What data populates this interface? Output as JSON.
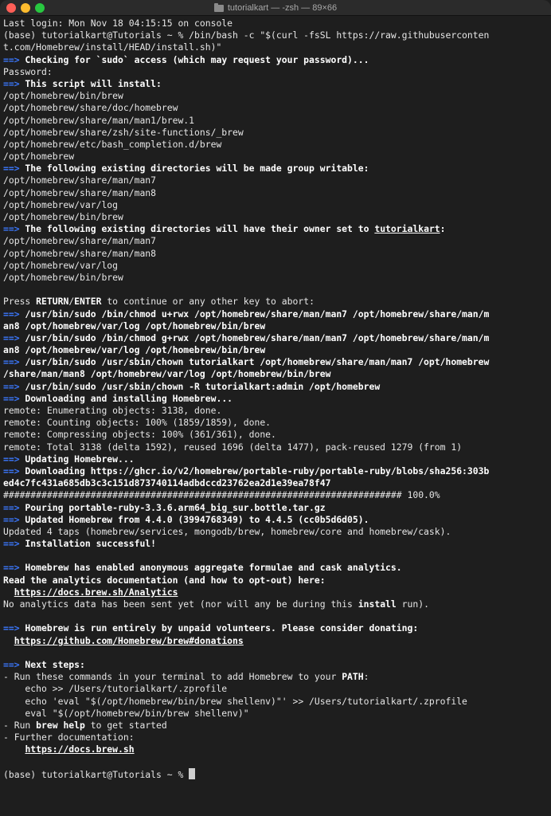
{
  "window": {
    "title": "tutorialkart — -zsh — 89×66"
  },
  "terminal": {
    "lines": [
      {
        "segments": [
          {
            "t": "text",
            "v": "Last login: Mon Nov 18 04:15:15 on console"
          }
        ]
      },
      {
        "segments": [
          {
            "t": "text",
            "v": "(base) tutorialkart@Tutorials ~ % /bin/bash -c \"$(curl -fsSL https://raw.githubuserconten"
          }
        ]
      },
      {
        "segments": [
          {
            "t": "text",
            "v": "t.com/Homebrew/install/HEAD/install.sh)\""
          }
        ]
      },
      {
        "segments": [
          {
            "t": "arrow",
            "v": "==>"
          },
          {
            "t": "bold",
            "v": " Checking for `sudo` access (which may request your password)..."
          }
        ]
      },
      {
        "segments": [
          {
            "t": "text",
            "v": "Password:"
          }
        ]
      },
      {
        "segments": [
          {
            "t": "arrow",
            "v": "==>"
          },
          {
            "t": "bold",
            "v": " This script will install:"
          }
        ]
      },
      {
        "segments": [
          {
            "t": "text",
            "v": "/opt/homebrew/bin/brew"
          }
        ]
      },
      {
        "segments": [
          {
            "t": "text",
            "v": "/opt/homebrew/share/doc/homebrew"
          }
        ]
      },
      {
        "segments": [
          {
            "t": "text",
            "v": "/opt/homebrew/share/man/man1/brew.1"
          }
        ]
      },
      {
        "segments": [
          {
            "t": "text",
            "v": "/opt/homebrew/share/zsh/site-functions/_brew"
          }
        ]
      },
      {
        "segments": [
          {
            "t": "text",
            "v": "/opt/homebrew/etc/bash_completion.d/brew"
          }
        ]
      },
      {
        "segments": [
          {
            "t": "text",
            "v": "/opt/homebrew"
          }
        ]
      },
      {
        "segments": [
          {
            "t": "arrow",
            "v": "==>"
          },
          {
            "t": "bold",
            "v": " The following existing directories will be made group writable:"
          }
        ]
      },
      {
        "segments": [
          {
            "t": "text",
            "v": "/opt/homebrew/share/man/man7"
          }
        ]
      },
      {
        "segments": [
          {
            "t": "text",
            "v": "/opt/homebrew/share/man/man8"
          }
        ]
      },
      {
        "segments": [
          {
            "t": "text",
            "v": "/opt/homebrew/var/log"
          }
        ]
      },
      {
        "segments": [
          {
            "t": "text",
            "v": "/opt/homebrew/bin/brew"
          }
        ]
      },
      {
        "segments": [
          {
            "t": "arrow",
            "v": "==>"
          },
          {
            "t": "bold",
            "v": " The following existing directories will have their owner set to "
          },
          {
            "t": "link",
            "v": "tutorialkart"
          },
          {
            "t": "bold",
            "v": ":"
          }
        ]
      },
      {
        "segments": [
          {
            "t": "text",
            "v": "/opt/homebrew/share/man/man7"
          }
        ]
      },
      {
        "segments": [
          {
            "t": "text",
            "v": "/opt/homebrew/share/man/man8"
          }
        ]
      },
      {
        "segments": [
          {
            "t": "text",
            "v": "/opt/homebrew/var/log"
          }
        ]
      },
      {
        "segments": [
          {
            "t": "text",
            "v": "/opt/homebrew/bin/brew"
          }
        ]
      },
      {
        "segments": [
          {
            "t": "text",
            "v": ""
          }
        ]
      },
      {
        "segments": [
          {
            "t": "text",
            "v": "Press "
          },
          {
            "t": "bold",
            "v": "RETURN"
          },
          {
            "t": "text",
            "v": "/"
          },
          {
            "t": "bold",
            "v": "ENTER"
          },
          {
            "t": "text",
            "v": " to continue or any other key to abort:"
          }
        ]
      },
      {
        "segments": [
          {
            "t": "arrow",
            "v": "==>"
          },
          {
            "t": "bold",
            "v": " /usr/bin/sudo /bin/chmod u+rwx /opt/homebrew/share/man/man7 /opt/homebrew/share/man/m"
          }
        ]
      },
      {
        "segments": [
          {
            "t": "bold",
            "v": "an8 /opt/homebrew/var/log /opt/homebrew/bin/brew"
          }
        ]
      },
      {
        "segments": [
          {
            "t": "arrow",
            "v": "==>"
          },
          {
            "t": "bold",
            "v": " /usr/bin/sudo /bin/chmod g+rwx /opt/homebrew/share/man/man7 /opt/homebrew/share/man/m"
          }
        ]
      },
      {
        "segments": [
          {
            "t": "bold",
            "v": "an8 /opt/homebrew/var/log /opt/homebrew/bin/brew"
          }
        ]
      },
      {
        "segments": [
          {
            "t": "arrow",
            "v": "==>"
          },
          {
            "t": "bold",
            "v": " /usr/bin/sudo /usr/sbin/chown tutorialkart /opt/homebrew/share/man/man7 /opt/homebrew"
          }
        ]
      },
      {
        "segments": [
          {
            "t": "bold",
            "v": "/share/man/man8 /opt/homebrew/var/log /opt/homebrew/bin/brew"
          }
        ]
      },
      {
        "segments": [
          {
            "t": "arrow",
            "v": "==>"
          },
          {
            "t": "bold",
            "v": " /usr/bin/sudo /usr/sbin/chown -R tutorialkart:admin /opt/homebrew"
          }
        ]
      },
      {
        "segments": [
          {
            "t": "arrow",
            "v": "==>"
          },
          {
            "t": "bold",
            "v": " Downloading and installing Homebrew..."
          }
        ]
      },
      {
        "segments": [
          {
            "t": "text",
            "v": "remote: Enumerating objects: 3138, done."
          }
        ]
      },
      {
        "segments": [
          {
            "t": "text",
            "v": "remote: Counting objects: 100% (1859/1859), done."
          }
        ]
      },
      {
        "segments": [
          {
            "t": "text",
            "v": "remote: Compressing objects: 100% (361/361), done."
          }
        ]
      },
      {
        "segments": [
          {
            "t": "text",
            "v": "remote: Total 3138 (delta 1592), reused 1696 (delta 1477), pack-reused 1279 (from 1)"
          }
        ]
      },
      {
        "segments": [
          {
            "t": "arrow",
            "v": "==>"
          },
          {
            "t": "bold",
            "v": " Updating Homebrew..."
          }
        ]
      },
      {
        "segments": [
          {
            "t": "arrow",
            "v": "==>"
          },
          {
            "t": "bold",
            "v": " Downloading https://ghcr.io/v2/homebrew/portable-ruby/portable-ruby/blobs/sha256:303b"
          }
        ]
      },
      {
        "segments": [
          {
            "t": "bold",
            "v": "ed4c7fc431a685db3c3c151d873740114adbdccd23762ea2d1e39ea78f47"
          }
        ]
      },
      {
        "segments": [
          {
            "t": "text",
            "v": "######################################################################### 100.0%"
          }
        ]
      },
      {
        "segments": [
          {
            "t": "arrow",
            "v": "==>"
          },
          {
            "t": "bold",
            "v": " Pouring portable-ruby-3.3.6.arm64_big_sur.bottle.tar.gz"
          }
        ]
      },
      {
        "segments": [
          {
            "t": "arrow",
            "v": "==>"
          },
          {
            "t": "bold",
            "v": " Updated Homebrew from 4.4.0 (3994768349) to 4.4.5 (cc0b5d6d05)."
          }
        ]
      },
      {
        "segments": [
          {
            "t": "text",
            "v": "Updated 4 taps (homebrew/services, mongodb/brew, homebrew/core and homebrew/cask)."
          }
        ]
      },
      {
        "segments": [
          {
            "t": "arrow",
            "v": "==>"
          },
          {
            "t": "bold",
            "v": " Installation successful!"
          }
        ]
      },
      {
        "segments": [
          {
            "t": "text",
            "v": ""
          }
        ]
      },
      {
        "segments": [
          {
            "t": "arrow",
            "v": "==>"
          },
          {
            "t": "bold",
            "v": " Homebrew has enabled anonymous aggregate formulae and cask analytics."
          }
        ]
      },
      {
        "segments": [
          {
            "t": "bold",
            "v": "Read the analytics documentation (and how to opt-out) here:"
          }
        ]
      },
      {
        "segments": [
          {
            "t": "text",
            "v": "  "
          },
          {
            "t": "link",
            "v": "https://docs.brew.sh/Analytics"
          }
        ]
      },
      {
        "segments": [
          {
            "t": "text",
            "v": "No analytics data has been sent yet (nor will any be during this "
          },
          {
            "t": "bold",
            "v": "install"
          },
          {
            "t": "text",
            "v": " run)."
          }
        ]
      },
      {
        "segments": [
          {
            "t": "text",
            "v": ""
          }
        ]
      },
      {
        "segments": [
          {
            "t": "arrow",
            "v": "==>"
          },
          {
            "t": "bold",
            "v": " Homebrew is run entirely by unpaid volunteers. Please consider donating:"
          }
        ]
      },
      {
        "segments": [
          {
            "t": "text",
            "v": "  "
          },
          {
            "t": "link",
            "v": "https://github.com/Homebrew/brew#donations"
          }
        ]
      },
      {
        "segments": [
          {
            "t": "text",
            "v": ""
          }
        ]
      },
      {
        "segments": [
          {
            "t": "arrow",
            "v": "==>"
          },
          {
            "t": "bold",
            "v": " Next steps:"
          }
        ]
      },
      {
        "segments": [
          {
            "t": "text",
            "v": "- Run these commands in your terminal to add Homebrew to your "
          },
          {
            "t": "bold",
            "v": "PATH"
          },
          {
            "t": "text",
            "v": ":"
          }
        ]
      },
      {
        "segments": [
          {
            "t": "text",
            "v": "    echo >> /Users/tutorialkart/.zprofile"
          }
        ]
      },
      {
        "segments": [
          {
            "t": "text",
            "v": "    echo 'eval \"$(/opt/homebrew/bin/brew shellenv)\"' >> /Users/tutorialkart/.zprofile"
          }
        ]
      },
      {
        "segments": [
          {
            "t": "text",
            "v": "    eval \"$(/opt/homebrew/bin/brew shellenv)\""
          }
        ]
      },
      {
        "segments": [
          {
            "t": "text",
            "v": "- Run "
          },
          {
            "t": "bold",
            "v": "brew help"
          },
          {
            "t": "text",
            "v": " to get started"
          }
        ]
      },
      {
        "segments": [
          {
            "t": "text",
            "v": "- Further documentation:"
          }
        ]
      },
      {
        "segments": [
          {
            "t": "text",
            "v": "    "
          },
          {
            "t": "link",
            "v": "https://docs.brew.sh"
          }
        ]
      },
      {
        "segments": [
          {
            "t": "text",
            "v": ""
          }
        ]
      },
      {
        "segments": [
          {
            "t": "text",
            "v": "(base) tutorialkart@Tutorials ~ % "
          },
          {
            "t": "cursor",
            "v": ""
          }
        ]
      }
    ]
  }
}
